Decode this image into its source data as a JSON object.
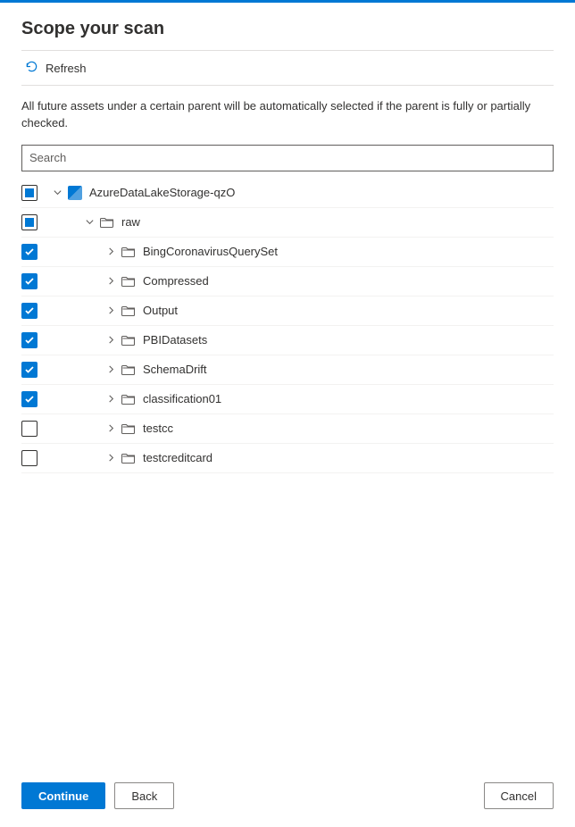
{
  "title": "Scope your scan",
  "toolbar": {
    "refresh_label": "Refresh"
  },
  "description": "All future assets under a certain parent will be automatically selected if the parent is fully or partially checked.",
  "search": {
    "placeholder": "Search"
  },
  "tree": {
    "root": {
      "label": "AzureDataLakeStorage-qzO",
      "state": "indeterminate",
      "expanded": true,
      "icon": "storage"
    },
    "children": [
      {
        "label": "raw",
        "state": "indeterminate",
        "expanded": true,
        "icon": "folder",
        "children": [
          {
            "label": "BingCoronavirusQuerySet",
            "state": "checked",
            "expanded": false,
            "icon": "folder"
          },
          {
            "label": "Compressed",
            "state": "checked",
            "expanded": false,
            "icon": "folder"
          },
          {
            "label": "Output",
            "state": "checked",
            "expanded": false,
            "icon": "folder"
          },
          {
            "label": "PBIDatasets",
            "state": "checked",
            "expanded": false,
            "icon": "folder"
          },
          {
            "label": "SchemaDrift",
            "state": "checked",
            "expanded": false,
            "icon": "folder"
          },
          {
            "label": "classification01",
            "state": "checked",
            "expanded": false,
            "icon": "folder"
          },
          {
            "label": "testcc",
            "state": "unchecked",
            "expanded": false,
            "icon": "folder"
          },
          {
            "label": "testcreditcard",
            "state": "unchecked",
            "expanded": false,
            "icon": "folder"
          }
        ]
      }
    ]
  },
  "footer": {
    "continue_label": "Continue",
    "back_label": "Back",
    "cancel_label": "Cancel"
  }
}
